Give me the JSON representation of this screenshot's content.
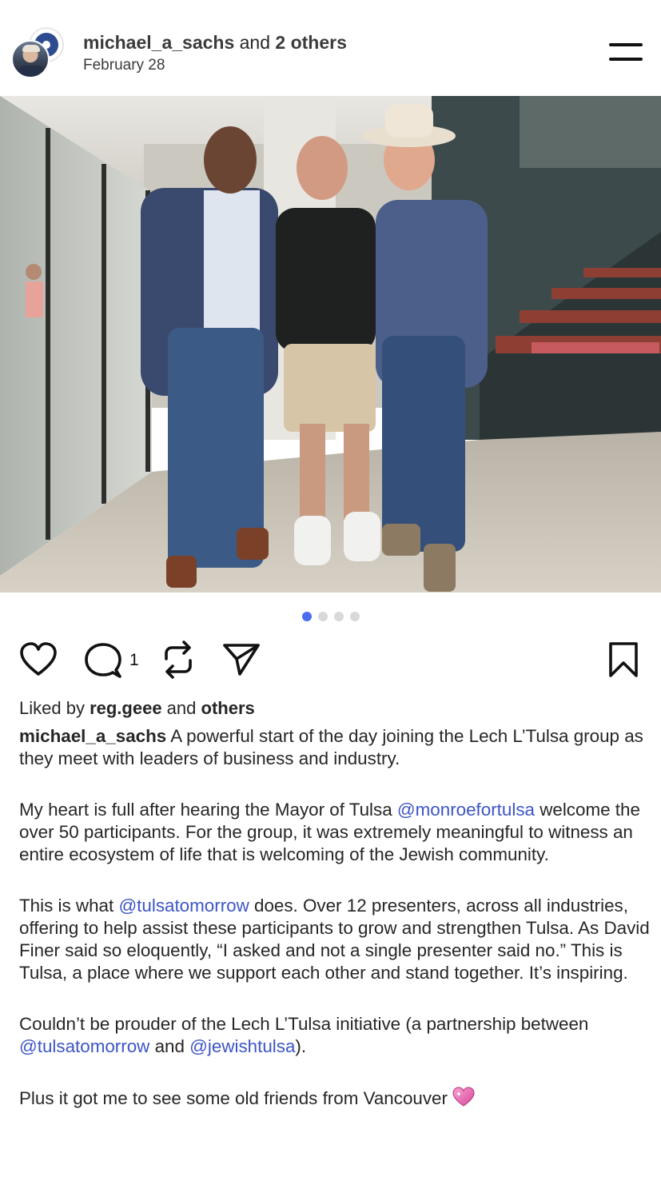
{
  "header": {
    "username": "michael_a_sachs",
    "connector": " and ",
    "others": "2 others",
    "date": "February 28"
  },
  "post": {
    "image_alt": "Three men posing in an office lobby; the man on the right wears a white cowboy hat",
    "carousel": {
      "count": 4,
      "active_index": 0,
      "active_color": "#4a6cf0",
      "inactive_color": "#d9d9d9"
    }
  },
  "actions": {
    "like_icon": "heart-icon",
    "comment_icon": "comment-icon",
    "comment_count": "1",
    "repost_icon": "repost-icon",
    "share_icon": "send-icon",
    "save_icon": "bookmark-icon"
  },
  "likes": {
    "prefix": "Liked by ",
    "user": "reg.geee",
    "middle": " and ",
    "others": "others"
  },
  "caption": {
    "username": "michael_a_sachs",
    "p1": " A powerful start of the day joining the Lech L’Tulsa group as they meet with leaders of business and industry.",
    "p2_before": "My heart is full after hearing the Mayor of Tulsa ",
    "p2_mention": "@monroefortulsa",
    "p2_after": " welcome the over 50 participants. For the group, it was extremely meaningful to witness an entire ecosystem of life that is welcoming of the Jewish community.",
    "p3_before": "This is what ",
    "p3_mention": "@tulsatomorrow",
    "p3_after": " does. Over 12 presenters, across all industries, offering to help assist these participants to grow and strengthen Tulsa. As David Finer said so eloquently, “I asked and not a single presenter said no.” This is Tulsa, a place where we support each other and stand together. It’s inspiring.",
    "p4_before": "Couldn’t be prouder of the Lech L’Tulsa initiative (a partnership between ",
    "p4_mention1": "@tulsatomorrow",
    "p4_mid": " and ",
    "p4_mention2": "@jewishtulsa",
    "p4_after": ").",
    "p5": "Plus it got me to see some old friends from Vancouver",
    "p5_emoji": "sparkling-heart-icon"
  },
  "colors": {
    "mention": "#3c55c6",
    "text": "#262626"
  }
}
